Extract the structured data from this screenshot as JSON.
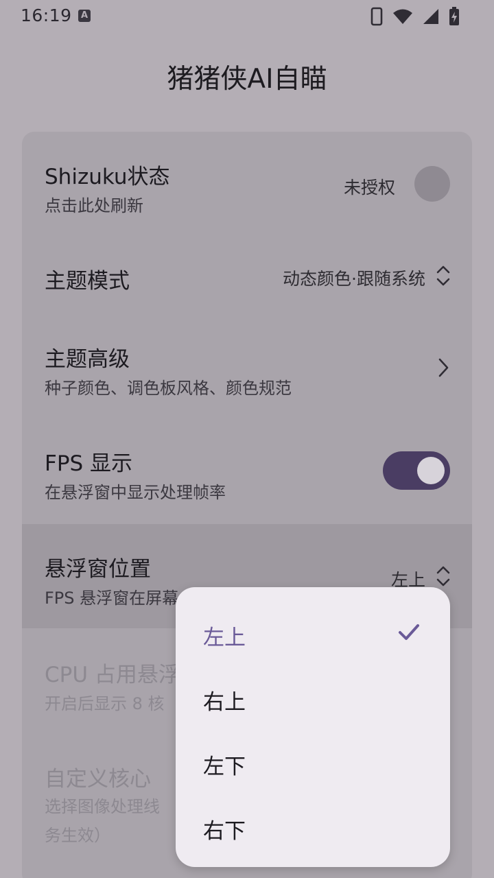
{
  "status_bar": {
    "time": "16:19",
    "notification_icon_letter": "A",
    "icons": [
      "phone-outline-icon",
      "wifi-icon",
      "signal-icon",
      "battery-charging-icon"
    ]
  },
  "app": {
    "title": "猪猪侠AI自瞄"
  },
  "settings": {
    "shizuku": {
      "title": "Shizuku状态",
      "subtitle": "点击此处刷新",
      "value": "未授权"
    },
    "theme_mode": {
      "title": "主题模式",
      "value": "动态颜色·跟随系统"
    },
    "theme_advanced": {
      "title": "主题高级",
      "subtitle": "种子颜色、调色板风格、颜色规范"
    },
    "fps_display": {
      "title": "FPS 显示",
      "subtitle": "在悬浮窗中显示处理帧率",
      "enabled": true
    },
    "overlay_position": {
      "title": "悬浮窗位置",
      "subtitle": "FPS 悬浮窗在屏幕上的显示位置",
      "value": "左上"
    },
    "cpu_overlay": {
      "title": "CPU 占用悬浮窗",
      "subtitle": "开启后显示 8 核"
    },
    "custom_cores": {
      "title": "自定义核心",
      "subtitle_line1": "选择图像处理线",
      "subtitle_line2": "务生效）"
    }
  },
  "dropdown": {
    "options": [
      {
        "label": "左上",
        "selected": true
      },
      {
        "label": "右上",
        "selected": false
      },
      {
        "label": "左下",
        "selected": false
      },
      {
        "label": "右下",
        "selected": false
      }
    ]
  },
  "colors": {
    "accent": "#6a5a98",
    "toggle_track": "#4a3d63",
    "scrim_background": "#b4aeb5"
  }
}
